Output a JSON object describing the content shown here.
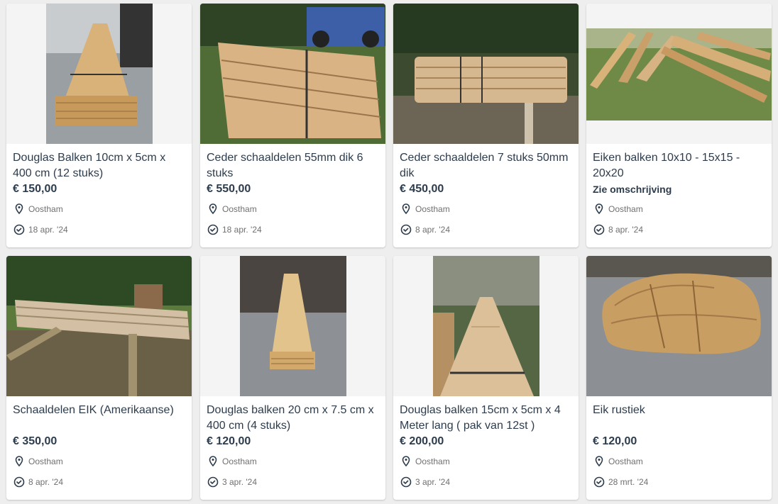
{
  "listings": [
    {
      "title": "Douglas Balken 10cm x 5cm x 400 cm (12 stuks)",
      "price": "€ 150,00",
      "location": "Oostham",
      "date": "18 apr. '24",
      "image": "stacked-douglas-beams-photo"
    },
    {
      "title": "Ceder schaaldelen 55mm dik 6 stuks",
      "price": "€ 550,00",
      "location": "Oostham",
      "date": "18 apr. '24",
      "image": "cedar-slabs-on-grass-photo"
    },
    {
      "title": "Ceder schaaldelen 7 stuks 50mm dik",
      "price": "€ 450,00",
      "location": "Oostham",
      "date": "8 apr. '24",
      "image": "cedar-slabs-stack-photo"
    },
    {
      "title": "Eiken balken 10x10 - 15x15 - 20x20",
      "price": "Zie omschrijving",
      "location": "Oostham",
      "date": "8 apr. '24",
      "image": "oak-beams-on-grass-photo"
    },
    {
      "title": "Schaaldelen EIK (Amerikaanse)",
      "price": "€ 350,00",
      "location": "Oostham",
      "date": "8 apr. '24",
      "image": "oak-slabs-outdoor-photo"
    },
    {
      "title": "Douglas balken 20 cm x 7.5 cm x 400 cm (4 stuks)",
      "price": "€ 120,00",
      "location": "Oostham",
      "date": "3 apr. '24",
      "image": "douglas-beams-warehouse-photo"
    },
    {
      "title": "Douglas balken 15cm x 5cm x 4 Meter lang ( pak van 12st )",
      "price": "€ 200,00",
      "location": "Oostham",
      "date": "3 apr. '24",
      "image": "douglas-beams-pack-photo"
    },
    {
      "title": "Eik rustiek",
      "price": "€ 120,00",
      "location": "Oostham",
      "date": "28 mrt. '24",
      "image": "rustic-oak-slabs-photo"
    }
  ],
  "colors": {
    "text": "#2d3c4d",
    "meta": "#707070",
    "card": "#ffffff",
    "page": "#eeeeee"
  }
}
